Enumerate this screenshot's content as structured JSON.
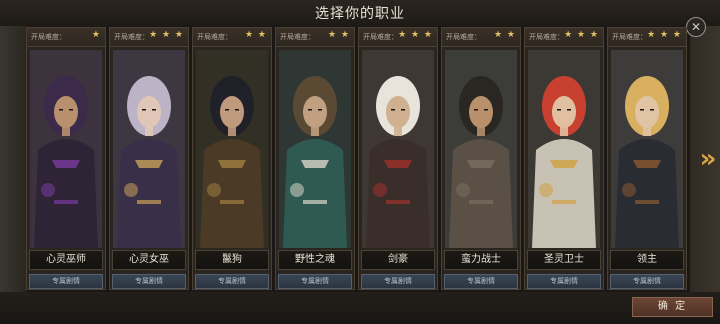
{
  "title": "选择你的职业",
  "close_icon": "✕",
  "next_icon": "»",
  "confirm_label": "确 定",
  "difficulty_label": "开局难度：",
  "cards": [
    {
      "name": "心灵巫师",
      "stars": "★",
      "story": "专属剧情",
      "palette": {
        "bg": "#4a3f4c",
        "hood": "#3b2a4a",
        "skin": "#b8906e",
        "cloth": "#2e2435",
        "accent": "#7a3aa0"
      }
    },
    {
      "name": "心灵女巫",
      "stars": "★ ★ ★",
      "story": "专属剧情",
      "palette": {
        "bg": "#4a4450",
        "hood": "#bdb3c6",
        "skin": "#e0c6b6",
        "cloth": "#3a2f48",
        "accent": "#c9a15a"
      }
    },
    {
      "name": "鬣狗",
      "stars": "★ ★",
      "story": "专属剧情",
      "palette": {
        "bg": "#3d3a2e",
        "hood": "#1f2028",
        "skin": "#c09a7c",
        "cloth": "#4a3a26",
        "accent": "#a08040"
      }
    },
    {
      "name": "野性之魂",
      "stars": "★ ★",
      "story": "专属剧情",
      "palette": {
        "bg": "#3a4440",
        "hood": "#5a4a34",
        "skin": "#c0a080",
        "cloth": "#2e5a52",
        "accent": "#d8d4c8"
      }
    },
    {
      "name": "剑豪",
      "stars": "★ ★ ★",
      "story": "专属剧情",
      "palette": {
        "bg": "#4c4440",
        "hood": "#e8e4dc",
        "skin": "#d0b090",
        "cloth": "#3a2e2a",
        "accent": "#a0302c"
      }
    },
    {
      "name": "蛮力战士",
      "stars": "★ ★",
      "story": "专属剧情",
      "palette": {
        "bg": "#4a4a46",
        "hood": "#2a2622",
        "skin": "#b8906c",
        "cloth": "#5a5046",
        "accent": "#7a6e60"
      }
    },
    {
      "name": "圣灵卫士",
      "stars": "★ ★ ★",
      "story": "专属剧情",
      "palette": {
        "bg": "#4a4640",
        "hood": "#c84030",
        "skin": "#e0c0a0",
        "cloth": "#c8c2b4",
        "accent": "#d0a040"
      }
    },
    {
      "name": "领主",
      "stars": "★ ★ ★",
      "story": "专属剧情",
      "palette": {
        "bg": "#4c4a48",
        "hood": "#d8b060",
        "skin": "#e0c4a4",
        "cloth": "#2a2c34",
        "accent": "#8a5a30"
      }
    }
  ]
}
